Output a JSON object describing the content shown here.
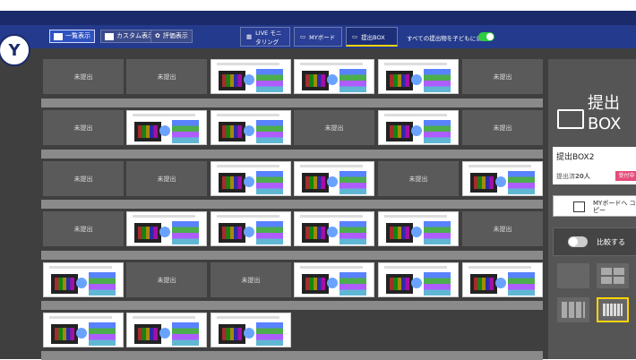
{
  "toolbar": {
    "view_list": "一覧表示",
    "view_custom": "カスタム表示",
    "view_eval": "評価表示",
    "tab_live": "LIVE モニタリング",
    "tab_myboard": "MYボード",
    "tab_submit": "提出BOX",
    "publish_all": "すべての提出物を子どもに公開"
  },
  "grid": {
    "empty_label": "未提出",
    "rows": [
      [
        "empty",
        "empty",
        "sub",
        "sub",
        "sub",
        "empty"
      ],
      [
        "empty",
        "sub",
        "sub",
        "empty",
        "sub",
        "empty"
      ],
      [
        "empty",
        "empty",
        "sub",
        "sub",
        "empty",
        "sub"
      ],
      [
        "empty",
        "sub",
        "sub",
        "sub",
        "sub",
        "empty"
      ],
      [
        "sub",
        "empty",
        "empty",
        "sub",
        "sub",
        "sub"
      ],
      [
        "sub",
        "sub",
        "sub"
      ]
    ]
  },
  "panel": {
    "title_top": "提出",
    "title_bottom": "BOX",
    "box_name": "提出BOX2",
    "count_label": "提出済",
    "count_value": "20人",
    "badge": "受付中",
    "copy_label": "MYボードへ コピー",
    "compare_label": "比較する"
  },
  "colors": {
    "header": "#1b2a6b",
    "accent": "#ffd400",
    "toggle_on": "#2ecc40",
    "badge": "#e64b7a"
  }
}
